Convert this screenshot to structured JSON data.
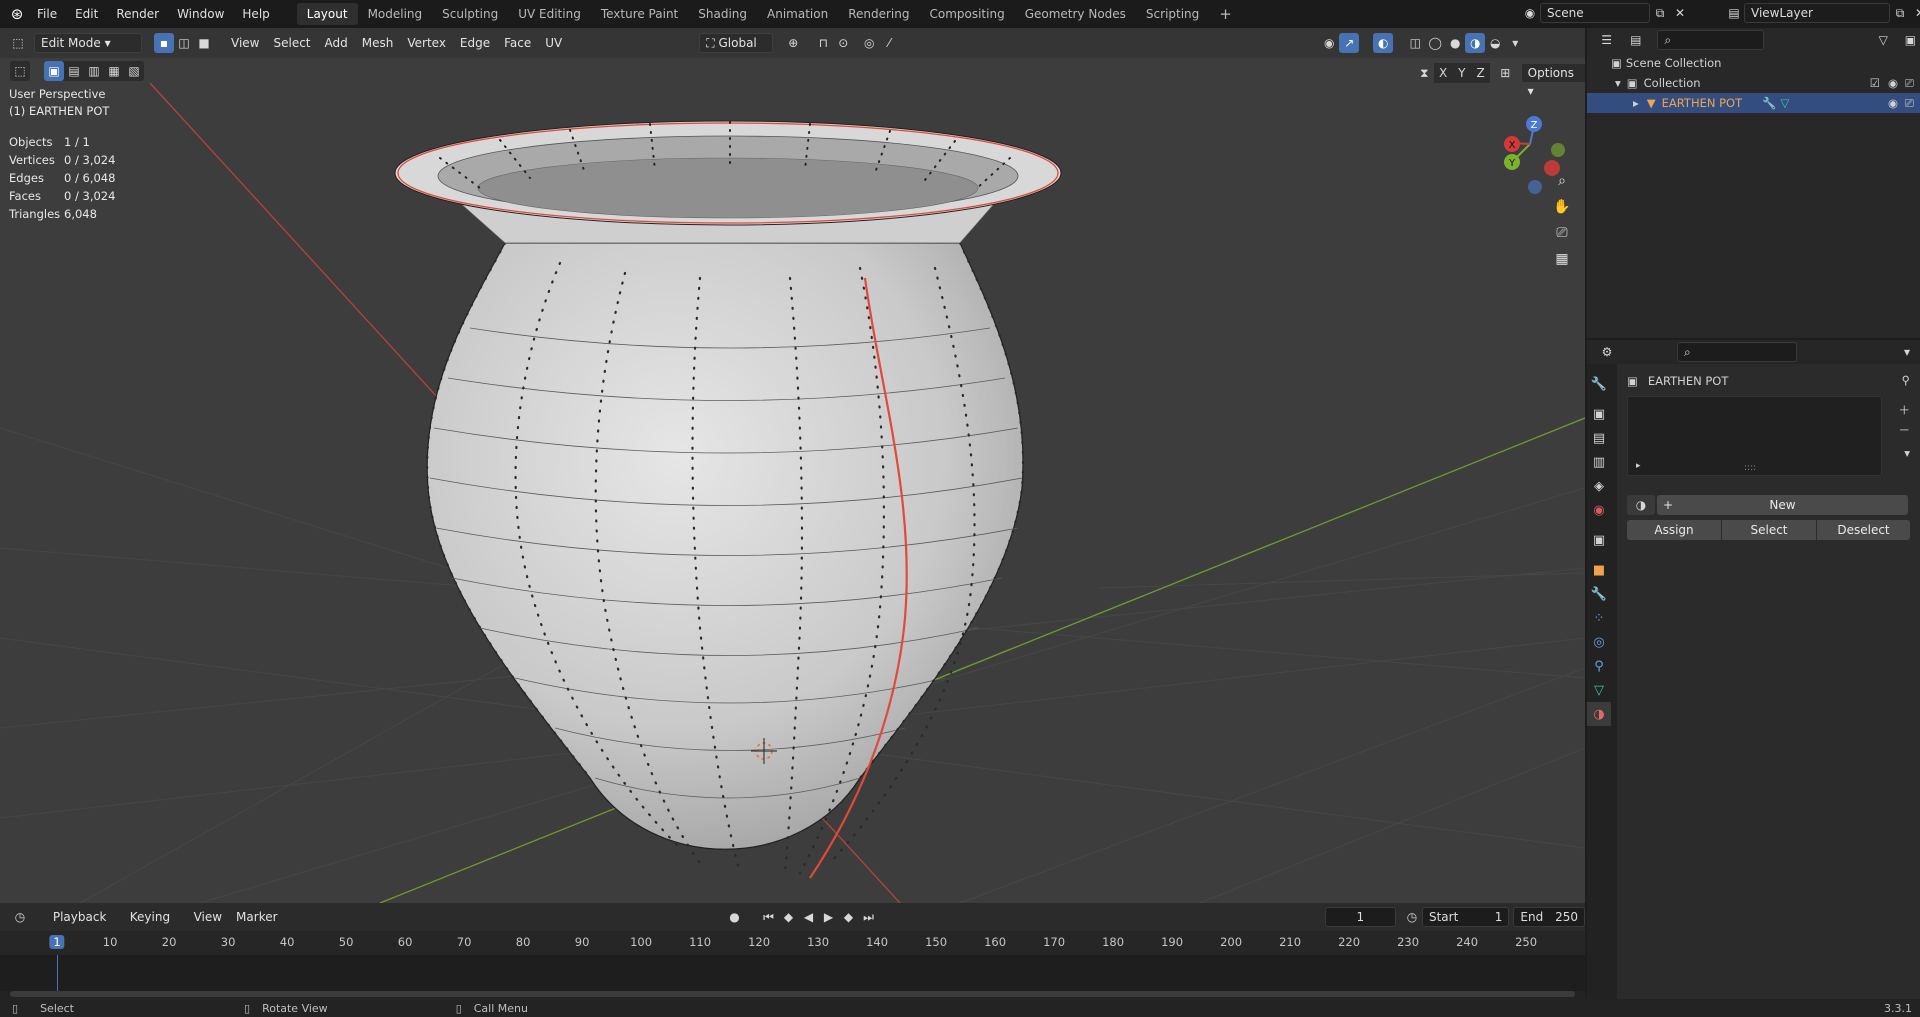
{
  "topbar": {
    "menus": [
      "File",
      "Edit",
      "Render",
      "Window",
      "Help"
    ],
    "workspaces": [
      "Layout",
      "Modeling",
      "Sculpting",
      "UV Editing",
      "Texture Paint",
      "Shading",
      "Animation",
      "Rendering",
      "Compositing",
      "Geometry Nodes",
      "Scripting"
    ],
    "active_workspace": "Layout",
    "add_tab": "+",
    "scene": "Scene",
    "view_layer": "ViewLayer"
  },
  "viewport": {
    "mode": "Edit Mode",
    "menus": [
      "View",
      "Select",
      "Add",
      "Mesh",
      "Vertex",
      "Edge",
      "Face",
      "UV"
    ],
    "orientation": "Global",
    "axes": [
      "X",
      "Y",
      "Z"
    ],
    "options_label": "Options",
    "perspective": "User Perspective",
    "object_label": "(1) EARTHEN POT",
    "stats": [
      {
        "label": "Objects",
        "value": "1 / 1"
      },
      {
        "label": "Vertices",
        "value": "0 / 3,024"
      },
      {
        "label": "Edges",
        "value": "0 / 6,048"
      },
      {
        "label": "Faces",
        "value": "0 / 3,024"
      },
      {
        "label": "Triangles",
        "value": "6,048"
      }
    ],
    "gizmo": {
      "z": "Z",
      "y": "Y",
      "x": "X"
    }
  },
  "timeline": {
    "menus": [
      "Playback",
      "Keying",
      "View",
      "Marker"
    ],
    "current_frame": "1",
    "start_label": "Start",
    "start": "1",
    "end_label": "End",
    "end": "250",
    "ticks": [
      "1",
      "10",
      "20",
      "30",
      "40",
      "50",
      "60",
      "70",
      "80",
      "90",
      "100",
      "110",
      "120",
      "130",
      "140",
      "150",
      "160",
      "170",
      "180",
      "190",
      "200",
      "210",
      "220",
      "230",
      "240",
      "250"
    ]
  },
  "statusbar": {
    "select": "Select",
    "rotate": "Rotate View",
    "call_menu": "Call Menu",
    "version": "3.3.1"
  },
  "outliner": {
    "scene_collection": "Scene Collection",
    "collection": "Collection",
    "object": "EARTHEN POT"
  },
  "properties": {
    "object_name": "EARTHEN POT",
    "new_label": "New",
    "assign_label": "Assign",
    "select_label": "Select",
    "deselect_label": "Deselect",
    "dots": "::::"
  },
  "colors": {
    "accent": "#4772b3",
    "seam": "#e04a3a",
    "x_axis": "#b7423c",
    "y_axis": "#6f9b2e",
    "active_text": "#f0a34a"
  }
}
